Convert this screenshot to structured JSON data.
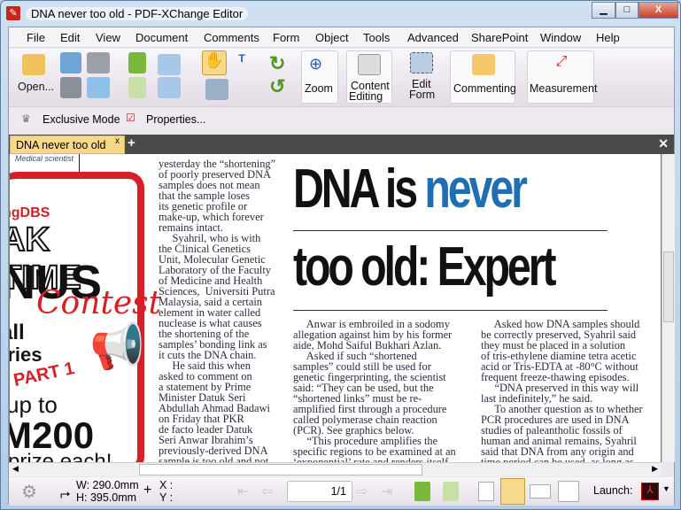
{
  "window": {
    "title": "DNA never too old - PDF-XChange Editor",
    "min": "▁",
    "max": "□",
    "close": "X"
  },
  "menu": [
    "File",
    "Edit",
    "View",
    "Document",
    "Comments",
    "Form",
    "Object",
    "Tools",
    "Advanced",
    "SharePoint",
    "Window",
    "Help"
  ],
  "toolbar": {
    "open": "Open...",
    "zoom": "Zoom",
    "content_editing_1": "Content",
    "content_editing_2": "Editing",
    "edit_form_1": "Edit",
    "edit_form_2": "Form",
    "commenting": "Commenting",
    "measurement": "Measurement",
    "exclusive_mode": "Exclusive Mode",
    "properties": "Properties..."
  },
  "tabs": [
    {
      "label": "DNA never too old",
      "close": "x"
    }
  ],
  "document": {
    "caption": "Medical scientist",
    "ad": {
      "brand": "ngDBS",
      "line1": "AK TIME",
      "line2": "NUS",
      "line3": "Contest",
      "line4": "all",
      "line5": "tries",
      "line6": "PART 1",
      "line7": "up to",
      "line8": "M200",
      "line9": "prize each!"
    },
    "headline": {
      "part1": "DNA is ",
      "part2": "never",
      "line2": "too old: Expert",
      "accent": "#1f6db3"
    },
    "col1": [
      "yesterday the “shortening”",
      "of poorly preserved DNA",
      "samples does not mean",
      "that the sample loses",
      "its genetic profile or",
      "make-up, which forever",
      "remains intact.",
      "     Syahril, who is with",
      "the Clinical Genetics",
      "Unit, Molecular Genetic",
      "Laboratory of the Faculty",
      "of Medicine and Health",
      "Sciences,  Universiti Putra",
      "Malaysia, said a certain",
      "element in water called",
      "nuclease is what causes",
      "the shortening of the",
      "samples’ bonding link as",
      "it cuts the DNA chain.",
      "     He said this when",
      "asked to comment on",
      "a statement by Prime",
      "Minister Datuk Seri",
      "Abdullah Ahmad Badawi",
      "on Friday that PKR",
      "de facto leader Datuk",
      "Seri Anwar Ibrahim’s",
      "previously-derived DNA",
      "sample is too old and not"
    ],
    "col2": [
      "     Anwar is embroiled in a sodomy",
      "allegation against him by his former",
      "aide, Mohd Saiful Bukhari Azlan.",
      "     Asked if such “shortened",
      "samples” could still be used for",
      "genetic fingerprinting, the scientist",
      "said: “They can be used, but the",
      "“shortened links” must be re-",
      "amplified first through a procedure",
      "called polymerase chain reaction",
      "(PCR). See graphics below.",
      "     “This procedure amplifies the",
      "specific regions to be examined at an",
      "‘exponential’ rate and renders itself"
    ],
    "col3": [
      "     Asked how DNA samples should",
      "be correctly preserved, Syahril said",
      "they must be placed in a solution",
      "of tris-ethylene diamine tetra acetic",
      "acid or Tris-EDTA at -80°C without",
      "frequent freeze-thawing episodes.",
      "     “DNA preserved in this way will",
      "last indefinitely,” he said.",
      "     To another question as to whether",
      "PCR procedures are used in DNA",
      "studies of paleantholic fossils of",
      "human and animal remains, Syahril",
      "said that DNA from any origin and",
      "time period can be used, as long as"
    ]
  },
  "status": {
    "width": "W: 290.0mm",
    "height": "H: 395.0mm",
    "x": "X :",
    "y": "Y :",
    "page": "1/1",
    "launch": "Launch:"
  }
}
